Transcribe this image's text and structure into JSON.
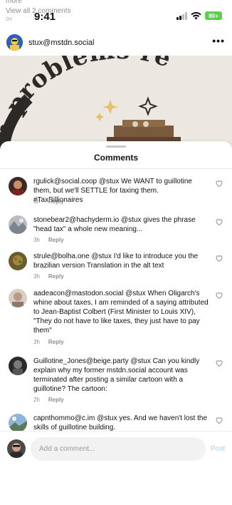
{
  "status_bar": {
    "time": "9:41",
    "battery": "80+"
  },
  "feed": {
    "more": "more",
    "view_all": "View all 2 comments",
    "time_ago": "2H"
  },
  "post": {
    "username": "stux@mstdn.social",
    "more_icon": "more-horizontal-icon",
    "image_text": "ern problems re"
  },
  "sheet": {
    "title": "Comments",
    "comments": [
      {
        "user": "rgulick@social.coop",
        "text": "@stux  We WANT to guillotine them, but we'll SETTLE for taxing them. #TaxBillionaires",
        "time": "3h",
        "reply": "Reply"
      },
      {
        "user": "stonebear2@hachyderm.io",
        "text": "@stux  gives the phrase \"head tax\" a whole new meaning...",
        "time": "3h",
        "reply": "Reply"
      },
      {
        "user": "strule@bolha.one",
        "text": "@stux  I'd like to introduce you the brazilian version Translation in the alt text",
        "time": "3h",
        "reply": "Reply"
      },
      {
        "user": "aadeacon@mastodon.social",
        "text": "@stux  When Oligarch's whine about taxes, I am reminded of a saying attributed to Jean-Baptist Colbert (First Minister to Louis XIV), \"They do not have to like taxes, they just have to pay them\"",
        "time": "3h",
        "reply": "Reply"
      },
      {
        "user": "Guillotine_Jones@beige.party",
        "text": "@stux   Can you kindly explain why my former mstdn.social account was terminated after posting a similar cartoon with a guillotine? The cartoon:",
        "time": "2h",
        "reply": "Reply"
      },
      {
        "user": "capnthommo@c.im",
        "text": "@stux  yes. And we haven't lost the skills of guillotine building.",
        "time": "",
        "reply": ""
      }
    ]
  },
  "composer": {
    "placeholder": "Add a comment...",
    "post_label": "Post"
  },
  "colors": {
    "accent": "#a6cdf5",
    "battery": "#5ad14b",
    "muted": "#8e8e8e"
  }
}
